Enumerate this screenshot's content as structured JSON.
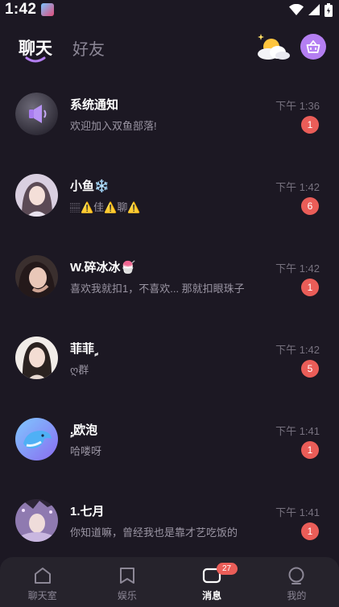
{
  "status_bar": {
    "time": "1:42"
  },
  "header": {
    "tabs": [
      {
        "label": "聊天",
        "active": true
      },
      {
        "label": "好友",
        "active": false
      }
    ],
    "weather_icon": "partly-cloudy-night-icon",
    "basket_icon": "basket-icon"
  },
  "conversations": [
    {
      "name": "系统通知",
      "preview": "欢迎加入双鱼部落!",
      "time": "下午 1:36",
      "unread": "1",
      "avatar": "megaphone-avatar"
    },
    {
      "name": "小鱼❄️",
      "preview": "🏽⚠️佳⚠️聊⚠️",
      "time": "下午 1:42",
      "unread": "6",
      "avatar": "girl-photo-avatar"
    },
    {
      "name": "W.碎冰冰🍧",
      "preview": "喜欢我就扣1，不喜欢... 那就扣眼珠子",
      "time": "下午 1:42",
      "unread": "1",
      "avatar": "girl-photo-avatar"
    },
    {
      "name": "菲菲ࣩ",
      "preview": "ღ群",
      "time": "下午 1:42",
      "unread": "5",
      "avatar": "girl-photo-avatar"
    },
    {
      "name": "ࣩ.欧泡",
      "preview": "哈喽呀",
      "time": "下午 1:41",
      "unread": "1",
      "avatar": "dolphin-avatar"
    },
    {
      "name": "1.七月",
      "preview": "你知道嘛，曾经我也是靠才艺吃饭的",
      "time": "下午 1:41",
      "unread": "1",
      "avatar": "decorated-frame-avatar"
    }
  ],
  "bottom_nav": {
    "items": [
      {
        "label": "聊天室",
        "icon": "home-icon",
        "active": false
      },
      {
        "label": "娱乐",
        "icon": "bookmark-icon",
        "active": false
      },
      {
        "label": "消息",
        "icon": "message-icon",
        "active": true,
        "badge": "27"
      },
      {
        "label": "我的",
        "icon": "profile-icon",
        "active": false
      }
    ]
  },
  "colors": {
    "background": "#1c1823",
    "accent_purple": "#b47ff2",
    "badge_red": "#ea5d58",
    "nav_background": "#26232c"
  }
}
